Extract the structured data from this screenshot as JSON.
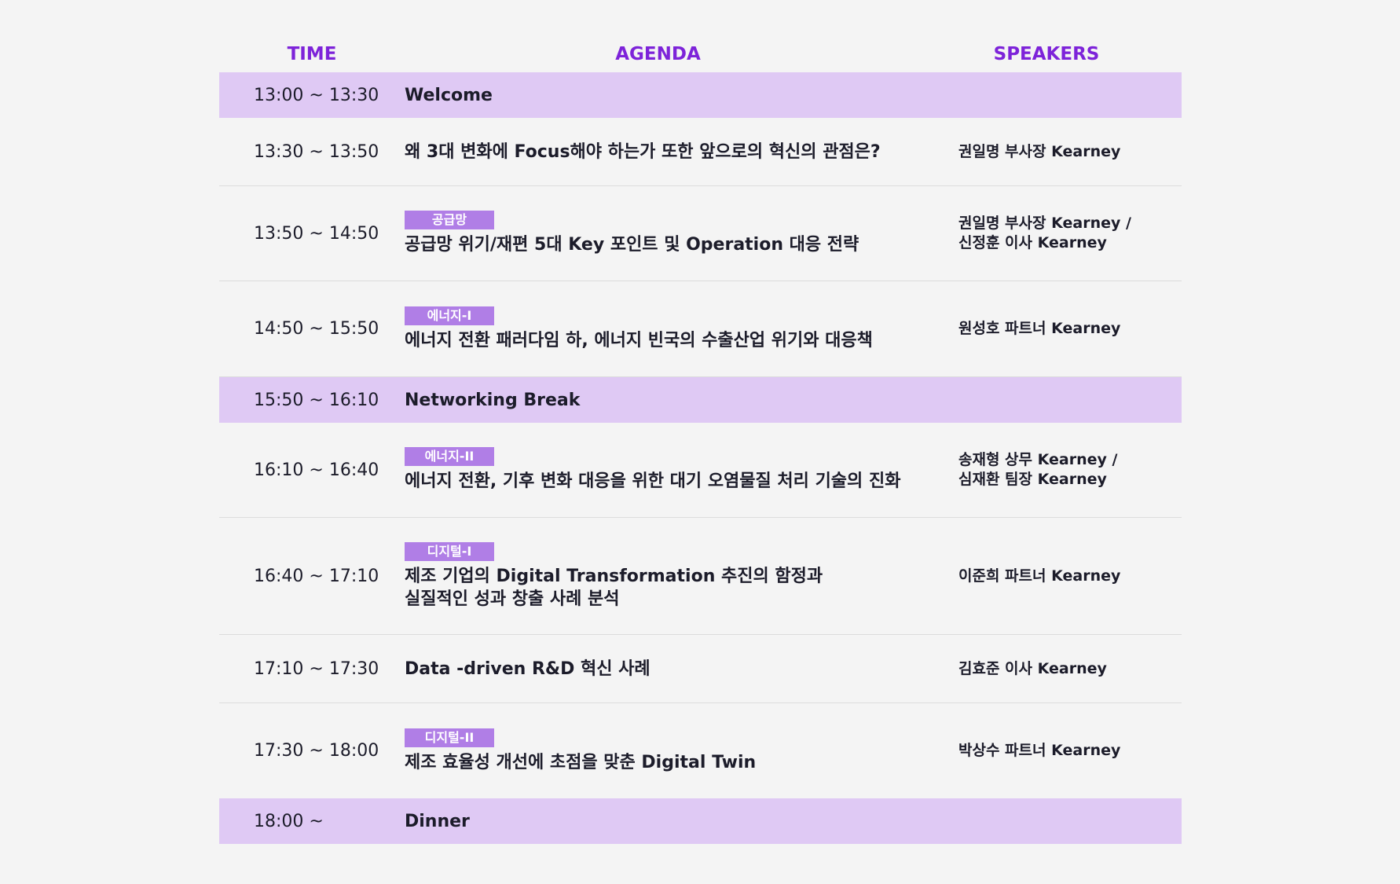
{
  "headers": {
    "time": "TIME",
    "agenda": "AGENDA",
    "speakers": "SPEAKERS"
  },
  "colors": {
    "header_text": "#7d23d9",
    "highlight_row": "#dfc9f4",
    "tag_background": "#b07ee6",
    "background": "#f4f4f4"
  },
  "rows": [
    {
      "time": "13:00 ~ 13:30",
      "tag": "",
      "title": "Welcome",
      "speakers": ""
    },
    {
      "time": "13:30 ~ 13:50",
      "tag": "",
      "title": "왜 3대 변화에 Focus해야 하는가 또한 앞으로의 혁신의 관점은?",
      "speakers": "권일명 부사장 Kearney"
    },
    {
      "time": "13:50 ~ 14:50",
      "tag": "공급망",
      "title": "공급망 위기/재편 5대 Key 포인트 및 Operation 대응 전략",
      "speakers": "권일명 부사장 Kearney /\n신정훈 이사 Kearney"
    },
    {
      "time": "14:50 ~ 15:50",
      "tag": "에너지-I",
      "title": "에너지 전환 패러다임 하, 에너지 빈국의 수출산업 위기와 대응책",
      "speakers": "원성호 파트너 Kearney"
    },
    {
      "time": "15:50 ~ 16:10",
      "tag": "",
      "title": "Networking Break",
      "speakers": ""
    },
    {
      "time": "16:10 ~ 16:40",
      "tag": "에너지-II",
      "title": "에너지 전환, 기후 변화 대응을 위한 대기 오염물질 처리 기술의 진화",
      "speakers": "송재형 상무 Kearney /\n심재환 팀장 Kearney"
    },
    {
      "time": "16:40 ~ 17:10",
      "tag": "디지털-I",
      "title": "제조 기업의 Digital Transformation 추진의 함정과\n실질적인 성과 창출 사례 분석",
      "speakers": "이준희 파트너 Kearney"
    },
    {
      "time": "17:10 ~ 17:30",
      "tag": "",
      "title": "Data -driven R&D 혁신 사례",
      "speakers": "김효준 이사 Kearney"
    },
    {
      "time": "17:30 ~ 18:00",
      "tag": "디지털-II",
      "title": "제조 효율성 개선에 초점을 맞춘 Digital Twin",
      "speakers": "박상수 파트너 Kearney"
    },
    {
      "time": "18:00 ~",
      "tag": "",
      "title": "Dinner",
      "speakers": ""
    }
  ]
}
